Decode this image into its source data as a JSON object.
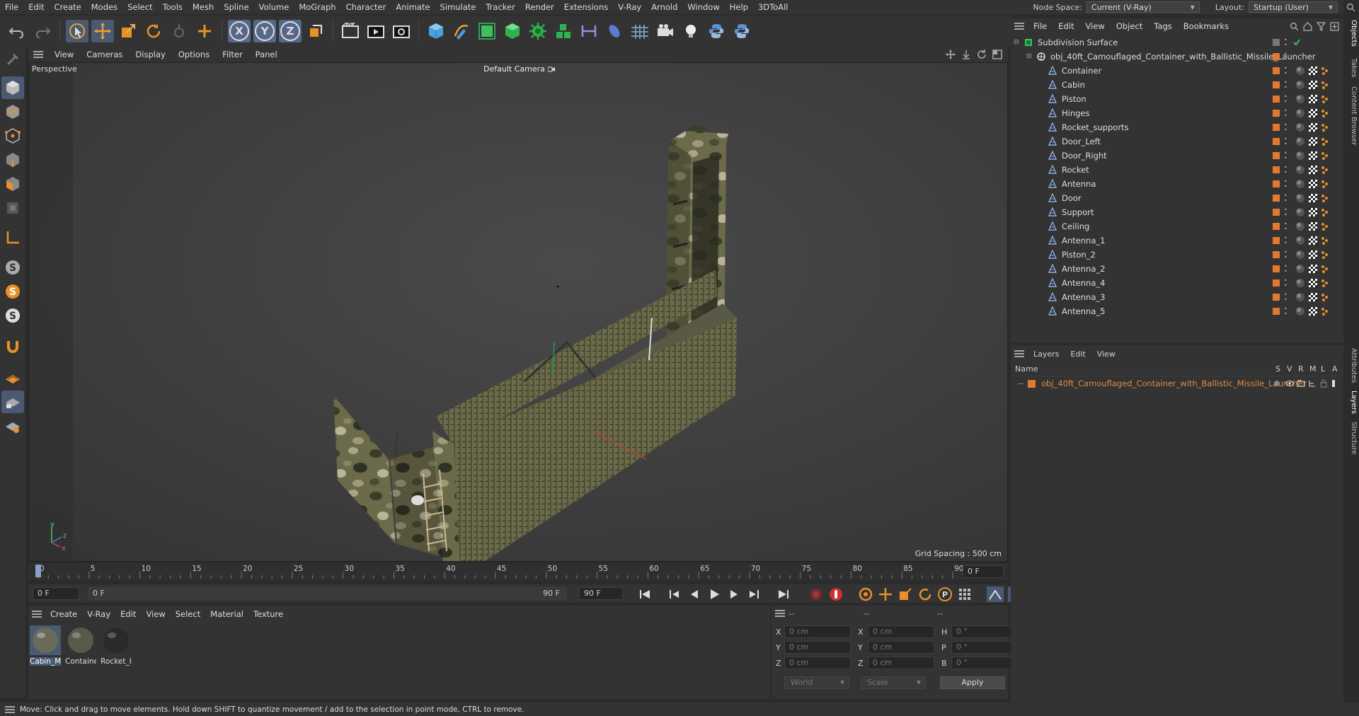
{
  "menubar": {
    "items": [
      "File",
      "Edit",
      "Create",
      "Modes",
      "Select",
      "Tools",
      "Mesh",
      "Spline",
      "Volume",
      "MoGraph",
      "Character",
      "Animate",
      "Simulate",
      "Tracker",
      "Render",
      "Extensions",
      "V-Ray",
      "Arnold",
      "Window",
      "Help",
      "3DToAll"
    ],
    "node_space_label": "Node Space:",
    "node_space_value": "Current (V-Ray)",
    "layout_label": "Layout:",
    "layout_value": "Startup (User)"
  },
  "toolbar": {
    "axis_x": "X",
    "axis_y": "Y",
    "axis_z": "Z"
  },
  "viewport": {
    "menu": [
      "View",
      "Cameras",
      "Display",
      "Options",
      "Filter",
      "Panel"
    ],
    "view_name": "Perspective",
    "camera_name": "Default Camera",
    "grid_spacing": "Grid Spacing : 500 cm",
    "axis_x": "x",
    "axis_y": "y",
    "axis_z": "z"
  },
  "timeline": {
    "ticks": [
      "0",
      "5",
      "10",
      "15",
      "20",
      "25",
      "30",
      "35",
      "40",
      "45",
      "50",
      "55",
      "60",
      "65",
      "70",
      "75",
      "80",
      "85",
      "90"
    ],
    "current_frame_right": "0 F",
    "start_field": "0 F",
    "range_start": "0 F",
    "range_end": "90 F",
    "end_field": "90 F"
  },
  "materials": {
    "menu": [
      "Create",
      "V-Ray",
      "Edit",
      "View",
      "Select",
      "Material",
      "Texture"
    ],
    "items": [
      "Cabin_M",
      "Containe",
      "Rocket_I"
    ]
  },
  "coords": {
    "headers": [
      "--",
      "--",
      "--"
    ],
    "rows": [
      {
        "a": "X",
        "av": "0 cm",
        "b": "X",
        "bv": "0 cm",
        "c": "H",
        "cv": "0 °"
      },
      {
        "a": "Y",
        "av": "0 cm",
        "b": "Y",
        "bv": "0 cm",
        "c": "P",
        "cv": "0 °"
      },
      {
        "a": "Z",
        "av": "0 cm",
        "b": "Z",
        "bv": "0 cm",
        "c": "B",
        "cv": "0 °"
      }
    ],
    "mode1": "World",
    "mode2": "Scale",
    "apply": "Apply"
  },
  "objects": {
    "menu": [
      "File",
      "Edit",
      "View",
      "Object",
      "Tags",
      "Bookmarks"
    ],
    "root": "Subdivision Surface",
    "group": "obj_40ft_Camouflaged_Container_with_Ballistic_Missile_Launcher",
    "children": [
      "Container",
      "Cabin",
      "Piston",
      "Hinges",
      "Rocket_supports",
      "Door_Left",
      "Door_Right",
      "Rocket",
      "Antenna",
      "Door",
      "Support",
      "Ceiling",
      "Antenna_1",
      "Piston_2",
      "Antenna_2",
      "Antenna_4",
      "Antenna_3",
      "Antenna_5"
    ]
  },
  "layers": {
    "menu": [
      "Layers",
      "Edit",
      "View"
    ],
    "header_name": "Name",
    "cols": [
      "S",
      "V",
      "R",
      "M",
      "L",
      "A"
    ],
    "layer_name": "obj_40ft_Camouflaged_Container_with_Ballistic_Missile_Launcher"
  },
  "side_tabs": [
    "Objects",
    "Takes",
    "Content Browser",
    "Attributes",
    "Layers",
    "Structure"
  ],
  "status": "Move: Click and drag to move elements. Hold down SHIFT to quantize movement / add to the selection in point mode, CTRL to remove.",
  "colors": {
    "accent_orange": "#e07a30",
    "selection_blue": "#4a5a72",
    "layer_text": "#e08a40"
  }
}
